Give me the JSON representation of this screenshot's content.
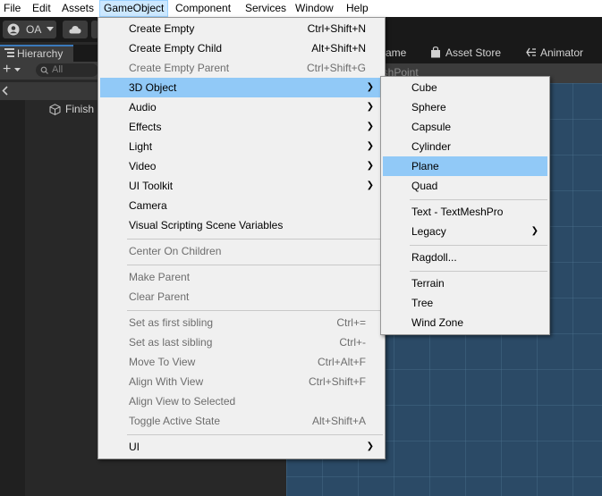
{
  "menubar": {
    "items": [
      "File",
      "Edit",
      "Assets",
      "GameObject",
      "Component",
      "Services",
      "Window",
      "Help"
    ],
    "active": "GameObject"
  },
  "toolbar": {
    "account_label": "OA"
  },
  "hierarchy": {
    "tab_label": "Hierarchy",
    "search_placeholder": "All",
    "root_item": "Finish"
  },
  "editor_tabs": {
    "game_fragment": "ame",
    "asset_store": "Asset Store",
    "animator": "Animator"
  },
  "scene": {
    "header_fragment": "ishPoint"
  },
  "gameobject_menu": {
    "items": [
      {
        "label": "Create Empty",
        "shortcut": "Ctrl+Shift+N",
        "enabled": true
      },
      {
        "label": "Create Empty Child",
        "shortcut": "Alt+Shift+N",
        "enabled": true
      },
      {
        "label": "Create Empty Parent",
        "shortcut": "Ctrl+Shift+G",
        "enabled": false
      },
      {
        "label": "3D Object",
        "submenu": true,
        "enabled": true,
        "highlighted": true
      },
      {
        "label": "Audio",
        "submenu": true,
        "enabled": true
      },
      {
        "label": "Effects",
        "submenu": true,
        "enabled": true
      },
      {
        "label": "Light",
        "submenu": true,
        "enabled": true
      },
      {
        "label": "Video",
        "submenu": true,
        "enabled": true
      },
      {
        "label": "UI Toolkit",
        "submenu": true,
        "enabled": true
      },
      {
        "label": "Camera",
        "enabled": true
      },
      {
        "label": "Visual Scripting Scene Variables",
        "enabled": true
      },
      {
        "label": "Center On Children",
        "enabled": false
      },
      {
        "label": "Make Parent",
        "enabled": false
      },
      {
        "label": "Clear Parent",
        "enabled": false
      },
      {
        "label": "Set as first sibling",
        "shortcut": "Ctrl+=",
        "enabled": false
      },
      {
        "label": "Set as last sibling",
        "shortcut": "Ctrl+-",
        "enabled": false
      },
      {
        "label": "Move To View",
        "shortcut": "Ctrl+Alt+F",
        "enabled": false
      },
      {
        "label": "Align With View",
        "shortcut": "Ctrl+Shift+F",
        "enabled": false
      },
      {
        "label": "Align View to Selected",
        "enabled": false
      },
      {
        "label": "Toggle Active State",
        "shortcut": "Alt+Shift+A",
        "enabled": false
      },
      {
        "label": "UI",
        "submenu": true,
        "enabled": true
      }
    ]
  },
  "object3d_submenu": {
    "items": [
      {
        "label": "Cube"
      },
      {
        "label": "Sphere"
      },
      {
        "label": "Capsule"
      },
      {
        "label": "Cylinder"
      },
      {
        "label": "Plane",
        "highlighted": true
      },
      {
        "label": "Quad"
      },
      {
        "label": "Text - TextMeshPro"
      },
      {
        "label": "Legacy",
        "submenu": true
      },
      {
        "label": "Ragdoll..."
      },
      {
        "label": "Terrain"
      },
      {
        "label": "Tree"
      },
      {
        "label": "Wind Zone"
      }
    ]
  },
  "colors": {
    "menu_highlight": "#91c9f7",
    "menubar_active": "#cce8ff",
    "disabled_text": "#6d6d6d",
    "editor_dark": "#282828",
    "scene_blue": "#2b4a66"
  }
}
